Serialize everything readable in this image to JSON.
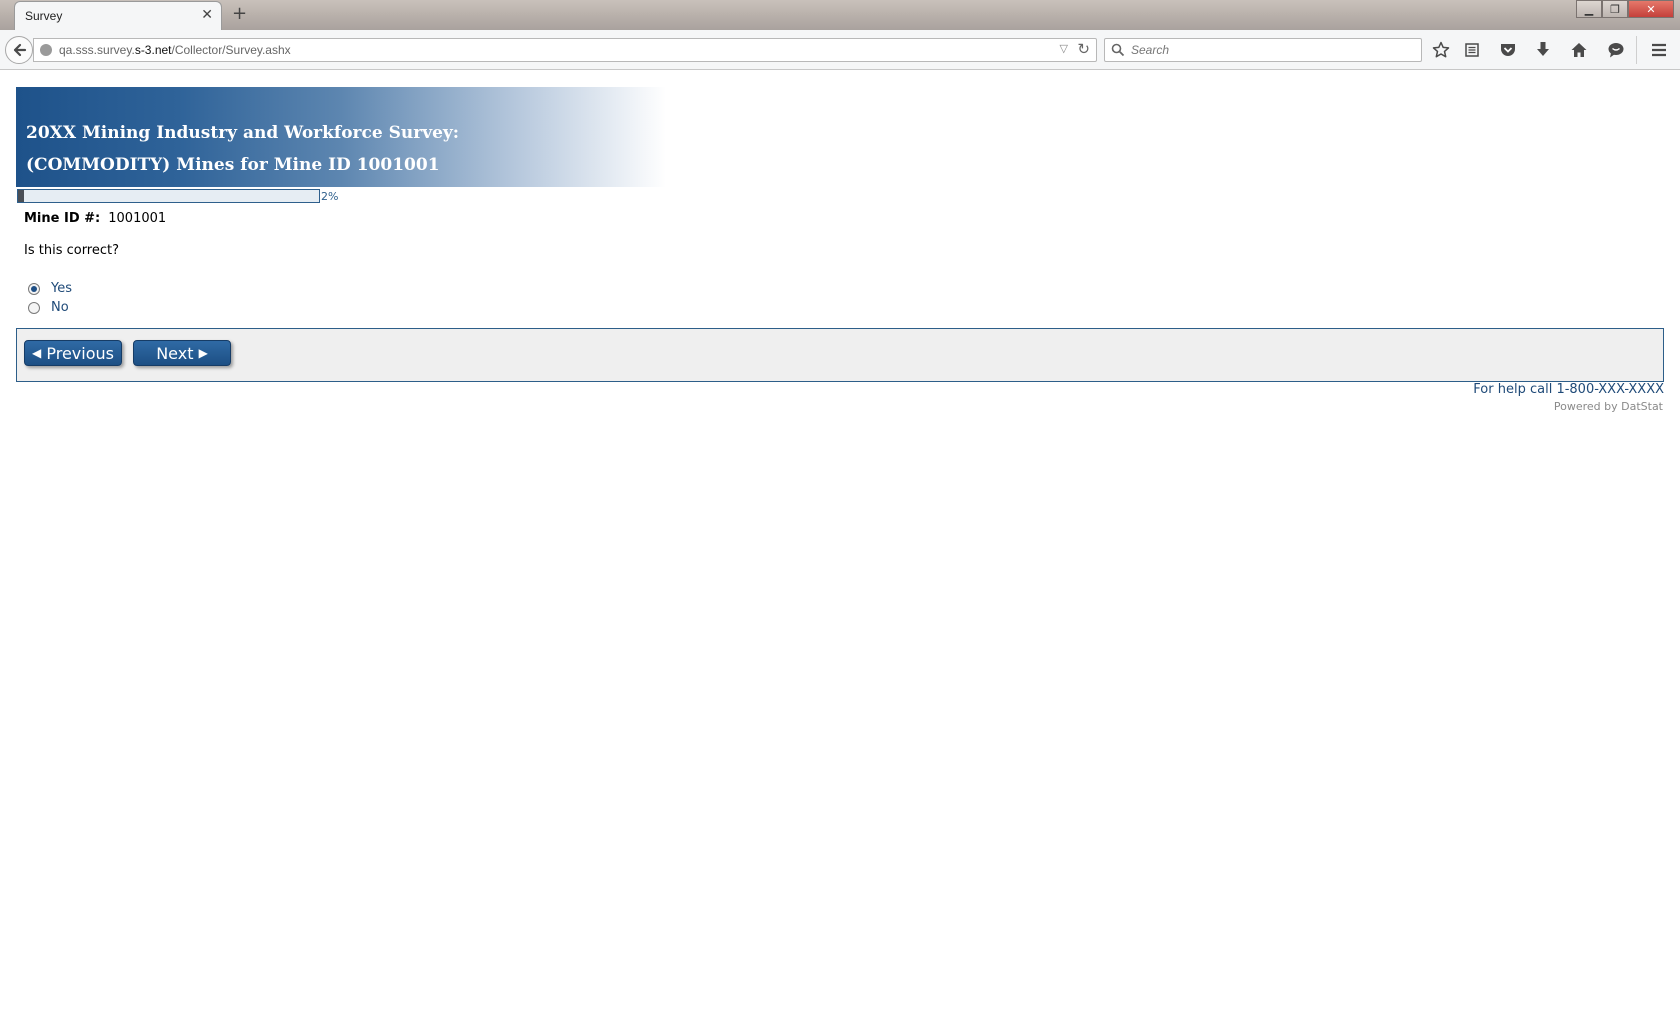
{
  "browser": {
    "tab_title": "Survey",
    "url_prefix": "qa.sss.survey.",
    "url_host": "s-3.net",
    "url_path": "/Collector/Survey.ashx",
    "search_placeholder": "Search"
  },
  "survey": {
    "title_line1": "20XX Mining Industry and Workforce Survey:",
    "title_line2": "(COMMODITY) Mines for Mine ID 1001001",
    "progress_percent": 2,
    "progress_label": "2%",
    "mine_id_label": "Mine ID #:",
    "mine_id_value": "1001001",
    "question": "Is this correct?",
    "options": [
      {
        "label": "Yes",
        "selected": true
      },
      {
        "label": "No",
        "selected": false
      }
    ]
  },
  "navigation": {
    "previous_label": "Previous",
    "next_label": "Next"
  },
  "footer": {
    "help_text": "For help call 1-800-XXX-XXXX",
    "powered_by": "Powered by DatStat"
  },
  "colors": {
    "banner_dark": "#1e528a",
    "button_blue": "#1d4f84",
    "link_blue": "#1f4a78"
  }
}
